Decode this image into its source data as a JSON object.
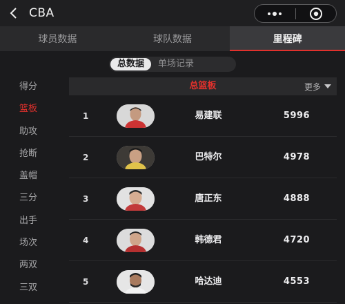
{
  "navbar": {
    "title": "CBA",
    "icons": {
      "back": "back-chevron-icon",
      "more": "more-dots-icon",
      "close": "target-close-icon"
    }
  },
  "tabs": [
    {
      "label": "球员数据",
      "active": false
    },
    {
      "label": "球队数据",
      "active": false
    },
    {
      "label": "里程碑",
      "active": true
    }
  ],
  "segment": [
    {
      "label": "总数据",
      "active": true
    },
    {
      "label": "单场记录",
      "active": false
    }
  ],
  "side": [
    {
      "label": "得分",
      "active": false
    },
    {
      "label": "篮板",
      "active": true
    },
    {
      "label": "助攻",
      "active": false
    },
    {
      "label": "抢断",
      "active": false
    },
    {
      "label": "盖帽",
      "active": false
    },
    {
      "label": "三分",
      "active": false
    },
    {
      "label": "出手",
      "active": false
    },
    {
      "label": "场次",
      "active": false
    },
    {
      "label": "两双",
      "active": false
    },
    {
      "label": "三双",
      "active": false
    }
  ],
  "table": {
    "title": "总篮板",
    "more_label": "更多",
    "rows": [
      {
        "rank": "1",
        "name": "易建联",
        "value": "5996",
        "avatar": "player-avatar"
      },
      {
        "rank": "2",
        "name": "巴特尔",
        "value": "4978",
        "avatar": "player-avatar"
      },
      {
        "rank": "3",
        "name": "唐正东",
        "value": "4888",
        "avatar": "player-avatar"
      },
      {
        "rank": "4",
        "name": "韩德君",
        "value": "4720",
        "avatar": "player-avatar"
      },
      {
        "rank": "5",
        "name": "哈达迪",
        "value": "4553",
        "avatar": "player-avatar"
      }
    ]
  },
  "colors": {
    "accent": "#e2312c",
    "background": "#1b1b1d",
    "header": "#2a2a2c"
  }
}
